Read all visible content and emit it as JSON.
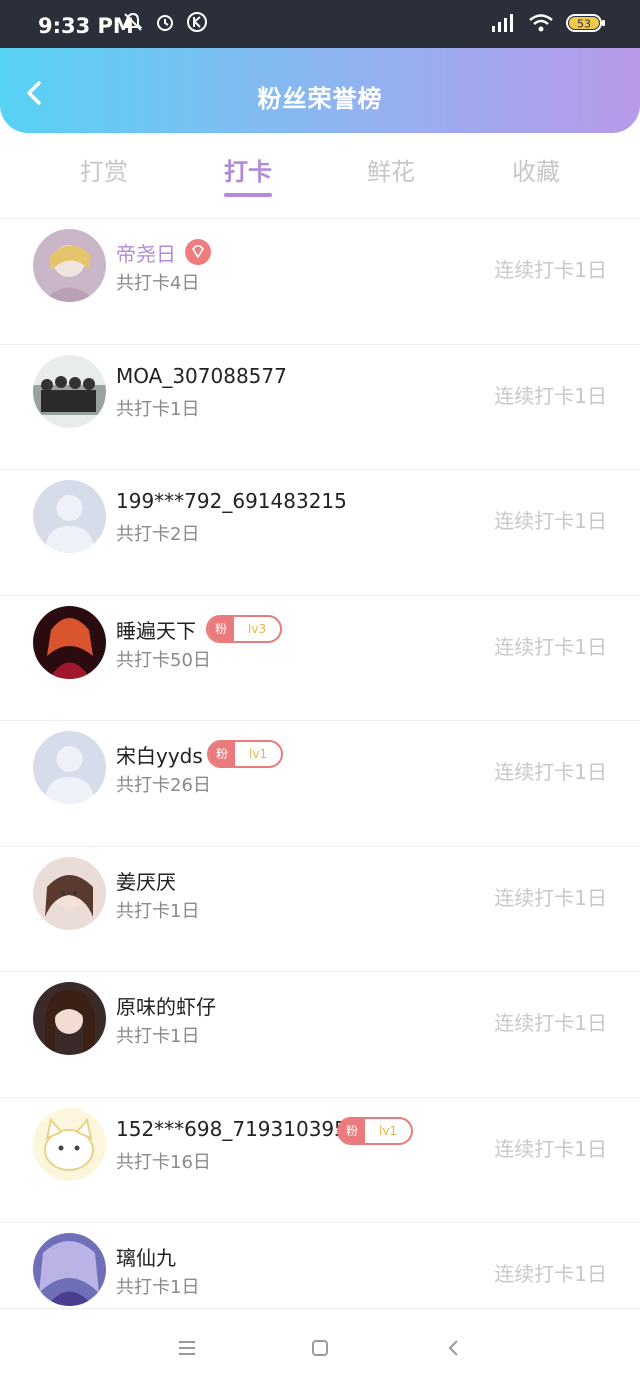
{
  "status": {
    "time": "9:33 PM",
    "battery": "53"
  },
  "header": {
    "title": "粉丝荣誉榜"
  },
  "tabs": [
    {
      "label": "打赏",
      "active": false
    },
    {
      "label": "打卡",
      "active": true
    },
    {
      "label": "鲜花",
      "active": false
    },
    {
      "label": "收藏",
      "active": false
    }
  ],
  "rows": [
    {
      "name": "帝尧日",
      "sub": "共打卡4日",
      "right": "连续打卡1日",
      "badge": "vip"
    },
    {
      "name": "MOA_307088577",
      "sub": "共打卡1日",
      "right": "连续打卡1日"
    },
    {
      "name": "199***792_691483215",
      "sub": "共打卡2日",
      "right": "连续打卡1日"
    },
    {
      "name": "睡遍天下",
      "sub": "共打卡50日",
      "right": "连续打卡1日",
      "badge": "fan",
      "fan_label": "粉",
      "level": "lv3"
    },
    {
      "name": "宋白yyds",
      "sub": "共打卡26日",
      "right": "连续打卡1日",
      "badge": "fan",
      "fan_label": "粉",
      "level": "lv1"
    },
    {
      "name": "姜厌厌",
      "sub": "共打卡1日",
      "right": "连续打卡1日"
    },
    {
      "name": "原味的虾仔",
      "sub": "共打卡1日",
      "right": "连续打卡1日"
    },
    {
      "name": "152***698_719310395",
      "sub": "共打卡16日",
      "right": "连续打卡1日",
      "badge": "fan",
      "fan_label": "粉",
      "level": "lv1"
    },
    {
      "name": "璃仙九",
      "sub": "共打卡1日",
      "right": "连续打卡1日"
    }
  ],
  "colors": {
    "accent": "#b18ad9",
    "badge": "#ea7a7c",
    "gradient_start": "#56d2f4",
    "gradient_end": "#b999ea"
  }
}
